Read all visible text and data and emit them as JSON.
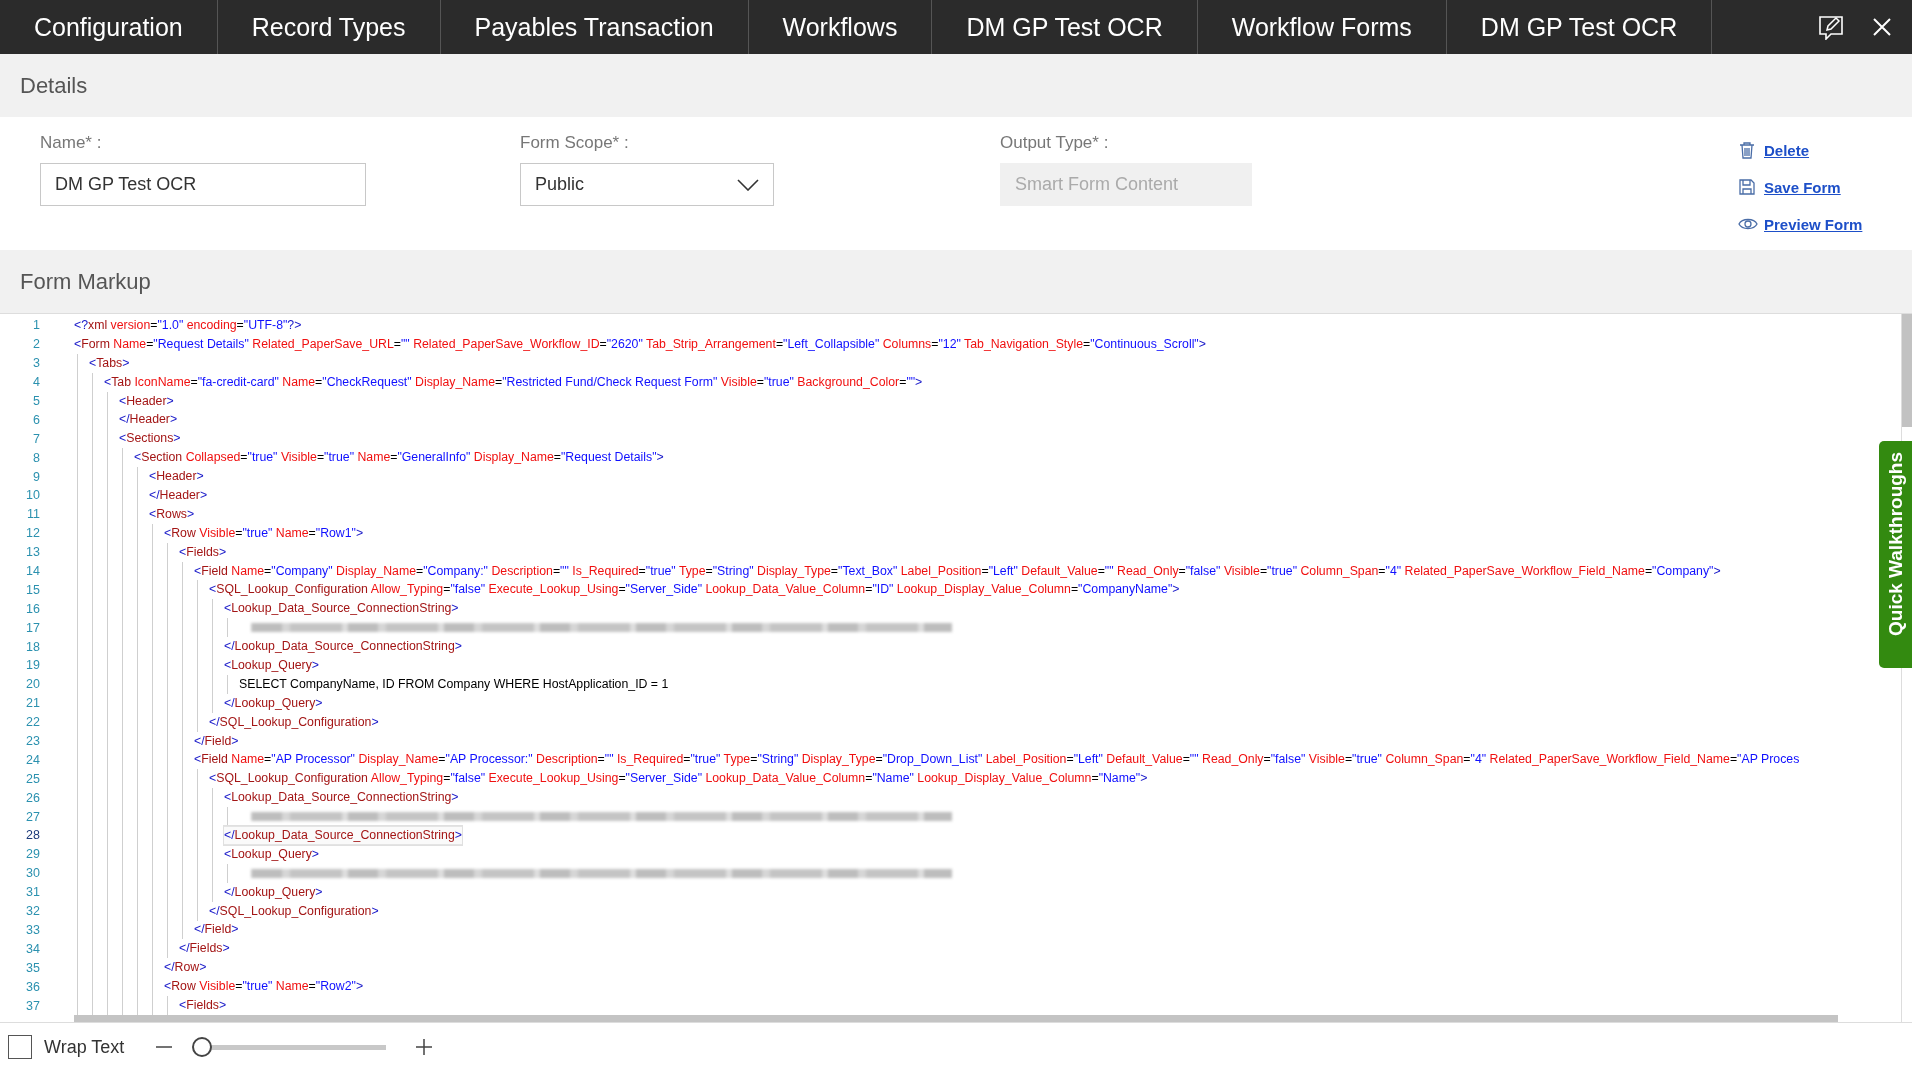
{
  "tabs": [
    {
      "label": "Configuration"
    },
    {
      "label": "Record Types"
    },
    {
      "label": "Payables Transaction"
    },
    {
      "label": "Workflows"
    },
    {
      "label": "DM GP Test OCR"
    },
    {
      "label": "Workflow Forms"
    },
    {
      "label": "DM GP Test OCR"
    }
  ],
  "details": {
    "title": "Details",
    "fields": [
      {
        "kind": "text",
        "label": "Name* :",
        "value": "DM GP Test OCR",
        "disabled": false
      },
      {
        "kind": "select",
        "label": "Form Scope* :",
        "value": "Public",
        "disabled": false
      },
      {
        "kind": "text",
        "label": "Output Type* :",
        "value": "Smart Form Content",
        "disabled": true
      }
    ],
    "actions": [
      {
        "kind": "delete",
        "label": "Delete"
      },
      {
        "kind": "save",
        "label": "Save Form"
      },
      {
        "kind": "preview",
        "label": "Preview Form"
      }
    ]
  },
  "markup": {
    "title": "Form Markup",
    "lines": [
      {
        "n": "1",
        "kind": "code",
        "selected": false,
        "text": "<?xml version=\"1.0\" encoding=\"UTF-8\"?>"
      },
      {
        "n": "2",
        "kind": "code",
        "selected": false,
        "text": "<Form Name=\"Request Details\" Related_PaperSave_URL=\"\" Related_PaperSave_Workflow_ID=\"2620\" Tab_Strip_Arrangement=\"Left_Collapsible\" Columns=\"12\" Tab_Navigation_Style=\"Continuous_Scroll\">",
        "children": [
          {
            "n": "3",
            "kind": "code",
            "selected": false,
            "text": "<Tabs>",
            "children": [
              {
                "n": "4",
                "kind": "code",
                "selected": false,
                "text": "<Tab IconName=\"fa-credit-card\" Name=\"CheckRequest\" Display_Name=\"Restricted Fund/Check Request Form\" Visible=\"true\" Background_Color=\"\">",
                "children": [
                  {
                    "n": "5",
                    "kind": "code",
                    "selected": false,
                    "text": "<Header>"
                  },
                  {
                    "n": "6",
                    "kind": "code",
                    "selected": false,
                    "text": "</Header>"
                  },
                  {
                    "n": "7",
                    "kind": "code",
                    "selected": false,
                    "text": "<Sections>",
                    "children": [
                      {
                        "n": "8",
                        "kind": "code",
                        "selected": false,
                        "text": "<Section Collapsed=\"true\" Visible=\"true\" Name=\"GeneralInfo\" Display_Name=\"Request Details\">",
                        "children": [
                          {
                            "n": "9",
                            "kind": "code",
                            "selected": false,
                            "text": "<Header>"
                          },
                          {
                            "n": "10",
                            "kind": "code",
                            "selected": false,
                            "text": "</Header>"
                          },
                          {
                            "n": "11",
                            "kind": "code",
                            "selected": false,
                            "text": "<Rows>",
                            "children": [
                              {
                                "n": "12",
                                "kind": "code",
                                "selected": false,
                                "text": "<Row Visible=\"true\" Name=\"Row1\">",
                                "children": [
                                  {
                                    "n": "13",
                                    "kind": "code",
                                    "selected": false,
                                    "text": "<Fields>",
                                    "children": [
                                      {
                                        "n": "14",
                                        "kind": "code",
                                        "selected": false,
                                        "text": "<Field Name=\"Company\" Display_Name=\"Company:\" Description=\"\" Is_Required=\"true\" Type=\"String\" Display_Type=\"Text_Box\" Label_Position=\"Left\" Default_Value=\"\" Read_Only=\"false\" Visible=\"true\" Column_Span=\"4\" Related_PaperSave_Workflow_Field_Name=\"Company\">",
                                        "children": [
                                          {
                                            "n": "15",
                                            "kind": "code",
                                            "selected": false,
                                            "text": "<SQL_Lookup_Configuration Allow_Typing=\"false\" Execute_Lookup_Using=\"Server_Side\" Lookup_Data_Value_Column=\"ID\" Lookup_Display_Value_Column=\"CompanyName\">",
                                            "children": [
                                              {
                                                "n": "16",
                                                "kind": "code",
                                                "selected": false,
                                                "text": "<Lookup_Data_Source_ConnectionString>",
                                                "children": [
                                                  {
                                                    "n": "17",
                                                    "kind": "redacted",
                                                    "selected": false
                                                  }
                                                ]
                                              },
                                              {
                                                "n": "18",
                                                "kind": "code",
                                                "selected": false,
                                                "text": "</Lookup_Data_Source_ConnectionString>"
                                              },
                                              {
                                                "n": "19",
                                                "kind": "code",
                                                "selected": false,
                                                "text": "<Lookup_Query>",
                                                "children": [
                                                  {
                                                    "n": "20",
                                                    "kind": "code",
                                                    "selected": false,
                                                    "text": "SELECT CompanyName, ID FROM Company WHERE HostApplication_ID = 1"
                                                  }
                                                ]
                                              },
                                              {
                                                "n": "21",
                                                "kind": "code",
                                                "selected": false,
                                                "text": "</Lookup_Query>"
                                              }
                                            ]
                                          },
                                          {
                                            "n": "22",
                                            "kind": "code",
                                            "selected": false,
                                            "text": "</SQL_Lookup_Configuration>"
                                          }
                                        ]
                                      },
                                      {
                                        "n": "23",
                                        "kind": "code",
                                        "selected": false,
                                        "text": "</Field>"
                                      },
                                      {
                                        "n": "24",
                                        "kind": "code",
                                        "selected": false,
                                        "text": "<Field Name=\"AP Processor\" Display_Name=\"AP Processor:\" Description=\"\" Is_Required=\"true\" Type=\"String\" Display_Type=\"Drop_Down_List\" Label_Position=\"Left\" Default_Value=\"\" Read_Only=\"false\" Visible=\"true\" Column_Span=\"4\" Related_PaperSave_Workflow_Field_Name=\"AP Proces",
                                        "children": [
                                          {
                                            "n": "25",
                                            "kind": "code",
                                            "selected": false,
                                            "text": "<SQL_Lookup_Configuration Allow_Typing=\"false\" Execute_Lookup_Using=\"Server_Side\" Lookup_Data_Value_Column=\"Name\" Lookup_Display_Value_Column=\"Name\">",
                                            "children": [
                                              {
                                                "n": "26",
                                                "kind": "code",
                                                "selected": false,
                                                "text": "<Lookup_Data_Source_ConnectionString>",
                                                "children": [
                                                  {
                                                    "n": "27",
                                                    "kind": "redacted",
                                                    "selected": false
                                                  }
                                                ]
                                              },
                                              {
                                                "n": "28",
                                                "kind": "code",
                                                "selected": true,
                                                "text": "</Lookup_Data_Source_ConnectionString>"
                                              },
                                              {
                                                "n": "29",
                                                "kind": "code",
                                                "selected": false,
                                                "text": "<Lookup_Query>",
                                                "children": [
                                                  {
                                                    "n": "30",
                                                    "kind": "redacted",
                                                    "selected": false
                                                  }
                                                ]
                                              },
                                              {
                                                "n": "31",
                                                "kind": "code",
                                                "selected": false,
                                                "text": "</Lookup_Query>"
                                              }
                                            ]
                                          },
                                          {
                                            "n": "32",
                                            "kind": "code",
                                            "selected": false,
                                            "text": "</SQL_Lookup_Configuration>"
                                          }
                                        ]
                                      },
                                      {
                                        "n": "33",
                                        "kind": "code",
                                        "selected": false,
                                        "text": "</Field>"
                                      }
                                    ]
                                  },
                                  {
                                    "n": "34",
                                    "kind": "code",
                                    "selected": false,
                                    "text": "</Fields>"
                                  }
                                ]
                              },
                              {
                                "n": "35",
                                "kind": "code",
                                "selected": false,
                                "text": "</Row>"
                              },
                              {
                                "n": "36",
                                "kind": "code",
                                "selected": false,
                                "text": "<Row Visible=\"true\" Name=\"Row2\">",
                                "children": [
                                  {
                                    "n": "37",
                                    "kind": "code",
                                    "selected": false,
                                    "text": "<Fields>"
                                  }
                                ]
                              }
                            ]
                          }
                        ]
                      }
                    ]
                  }
                ]
              }
            ]
          }
        ]
      }
    ]
  },
  "footer": {
    "wrap_text": {
      "label": "Wrap Text",
      "checked": false
    },
    "zoom": {
      "level": 0
    }
  },
  "quick_walkthroughs": {
    "label": "Quick Walkthroughs"
  }
}
